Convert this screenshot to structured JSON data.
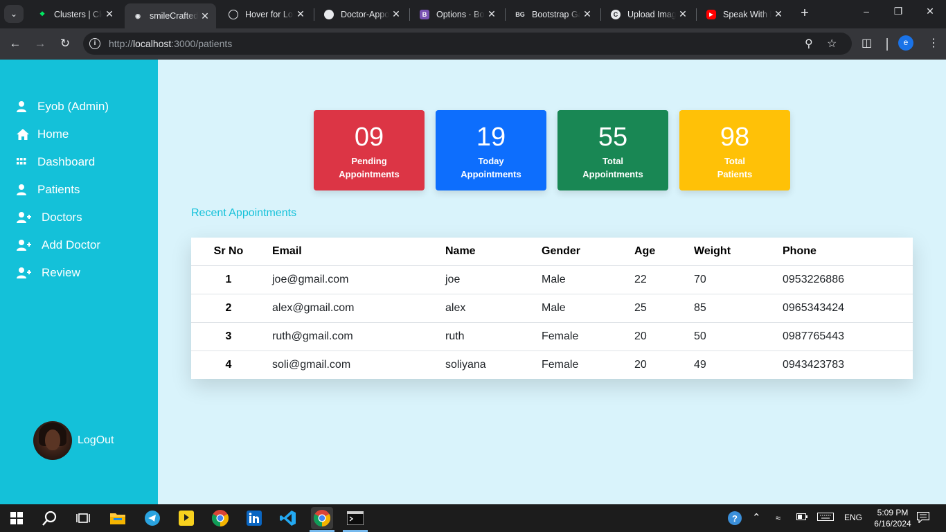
{
  "browser": {
    "tabs": [
      {
        "title": "Clusters | Cloud",
        "favicon": "mongodb-leaf-icon",
        "active": false
      },
      {
        "title": "smileCrafted",
        "favicon": "github-copilot-icon",
        "active": true
      },
      {
        "title": "Hover for Look",
        "favicon": "chatgpt-icon",
        "active": false
      },
      {
        "title": "Doctor-Appoint",
        "favicon": "github-icon",
        "active": false
      },
      {
        "title": "Options · Bootstrap",
        "favicon": "bootstrap-icon",
        "active": false
      },
      {
        "title": "Bootstrap Gallery",
        "favicon": "bootstrap-gallery-icon",
        "active": false
      },
      {
        "title": "Upload Image",
        "favicon": "cloudinary-icon",
        "active": false
      },
      {
        "title": "Speak With Me",
        "favicon": "youtube-icon",
        "active": false
      }
    ],
    "url_prefix": "http://",
    "url_host": "localhost",
    "url_path": ":3000/patients",
    "profile_initial": "e"
  },
  "sidebar": {
    "items": [
      {
        "label": "Eyob (Admin)",
        "icon": "user-icon"
      },
      {
        "label": "Home",
        "icon": "home-icon"
      },
      {
        "label": "Dashboard",
        "icon": "grid-icon"
      },
      {
        "label": "Patients",
        "icon": "user-icon"
      },
      {
        "label": "Doctors",
        "icon": "user-plus-icon"
      },
      {
        "label": "Add Doctor",
        "icon": "user-plus-icon"
      },
      {
        "label": "Review",
        "icon": "user-plus-icon"
      }
    ],
    "logout_label": "LogOut"
  },
  "stats": [
    {
      "value": "09",
      "line1": "Pending",
      "line2": "Appointments",
      "color": "#dc3545"
    },
    {
      "value": "19",
      "line1": "Today",
      "line2": "Appointments",
      "color": "#0d6efd"
    },
    {
      "value": "55",
      "line1": "Total",
      "line2": "Appointments",
      "color": "#198754"
    },
    {
      "value": "98",
      "line1": "Total",
      "line2": "Patients",
      "color": "#ffc107"
    }
  ],
  "recent": {
    "title": "Recent Appointments",
    "columns": [
      "Sr No",
      "Email",
      "Name",
      "Gender",
      "Age",
      "Weight",
      "Phone"
    ],
    "rows": [
      [
        "1",
        "joe@gmail.com",
        "joe",
        "Male",
        "22",
        "70",
        "0953226886"
      ],
      [
        "2",
        "alex@gmail.com",
        "alex",
        "Male",
        "25",
        "85",
        "0965343424"
      ],
      [
        "3",
        "ruth@gmail.com",
        "ruth",
        "Female",
        "20",
        "50",
        "0987765443"
      ],
      [
        "4",
        "soli@gmail.com",
        "soliyana",
        "Female",
        "20",
        "49",
        "0943423783"
      ]
    ]
  },
  "taskbar": {
    "language": "ENG",
    "time": "5:09 PM",
    "date": "6/16/2024"
  },
  "colors": {
    "sidebar": "#14c1d9",
    "page_bg": "#d9f3fb",
    "accent_text": "#14c1d9"
  }
}
